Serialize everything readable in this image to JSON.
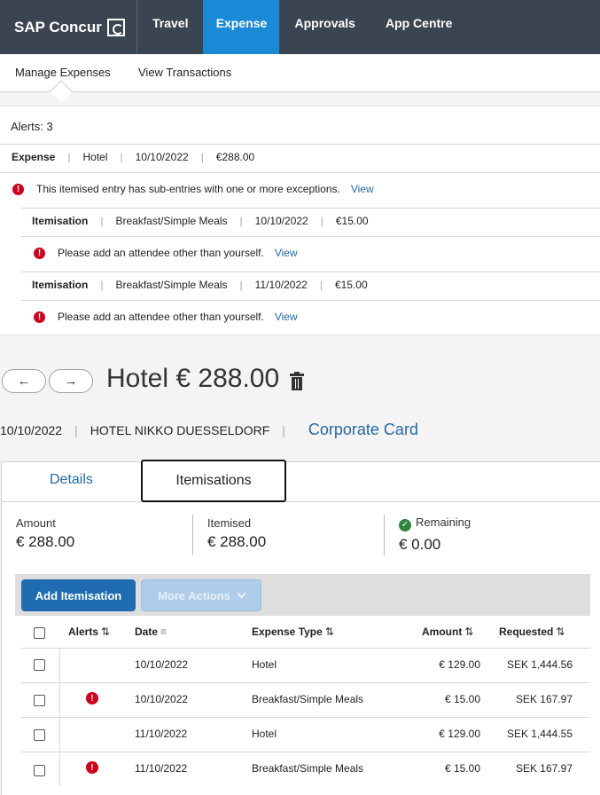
{
  "brand": {
    "name": "SAP Concur"
  },
  "nav": {
    "tabs": [
      {
        "label": "Travel"
      },
      {
        "label": "Expense"
      },
      {
        "label": "Approvals"
      },
      {
        "label": "App Centre"
      }
    ],
    "active_color": "#1a8ad6"
  },
  "subnav": {
    "items": [
      {
        "label": "Manage Expenses"
      },
      {
        "label": "View Transactions"
      }
    ]
  },
  "alerts": {
    "count_label": "Alerts: 3",
    "expense": {
      "type": "Expense",
      "name": "Hotel",
      "date": "10/10/2022",
      "amount": "€288.00"
    },
    "expense_error": {
      "text": "This itemised entry has sub-entries with one or more exceptions.",
      "link": "View"
    },
    "items": [
      {
        "type": "Itemisation",
        "name": "Breakfast/Simple Meals",
        "date": "10/10/2022",
        "amount": "€15.00",
        "error": "Please add an attendee other than yourself.",
        "link": "View"
      },
      {
        "type": "Itemisation",
        "name": "Breakfast/Simple Meals",
        "date": "11/10/2022",
        "amount": "€15.00",
        "error": "Please add an attendee other than yourself.",
        "link": "View"
      }
    ]
  },
  "header": {
    "prev_icon": "←",
    "next_icon": "→",
    "title": "Hotel € 288.00",
    "date": "10/10/2022",
    "vendor": "HOTEL NIKKO DUESSELDORF",
    "payment": "Corporate Card"
  },
  "tabs": {
    "details": "Details",
    "itemisations": "Itemisations"
  },
  "summary": {
    "amount_label": "Amount",
    "amount_value": "€ 288.00",
    "itemised_label": "Itemised",
    "itemised_value": "€ 288.00",
    "remaining_label": "Remaining",
    "remaining_value": "€ 0.00"
  },
  "toolbar": {
    "add_label": "Add Itemisation",
    "more_label": "More Actions"
  },
  "table": {
    "headers": {
      "alerts": "Alerts",
      "date": "Date",
      "type": "Expense Type",
      "amount": "Amount",
      "requested": "Requested"
    },
    "rows": [
      {
        "alert": false,
        "date": "10/10/2022",
        "type": "Hotel",
        "amount": "€ 129.00",
        "requested": "SEK 1,444.56"
      },
      {
        "alert": true,
        "date": "10/10/2022",
        "type": "Breakfast/Simple Meals",
        "amount": "€ 15.00",
        "requested": "SEK 167.97"
      },
      {
        "alert": false,
        "date": "11/10/2022",
        "type": "Hotel",
        "amount": "€ 129.00",
        "requested": "SEK 1,444.55"
      },
      {
        "alert": true,
        "date": "11/10/2022",
        "type": "Breakfast/Simple Meals",
        "amount": "€ 15.00",
        "requested": "SEK 167.97"
      }
    ]
  }
}
